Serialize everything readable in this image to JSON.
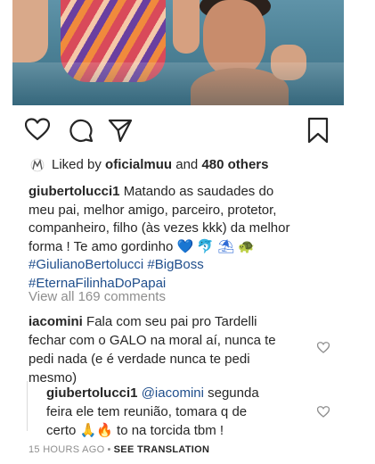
{
  "post": {
    "liked_by_prefix": "Liked by ",
    "liked_by_user": "oficialmuu",
    "liked_by_mid": " and ",
    "liked_by_count": "480 others",
    "author": "giubertolucci1",
    "caption_lines": [
      " Matando as saudades do",
      "meu pai, melhor amigo, parceiro, protetor,",
      "companheiro, filho (às vezes kkk) da melhor",
      "forma ! Te amo gordinho "
    ],
    "caption_emojis": "💙 🐬 ⛱ 🐢",
    "hashtags_line1": "#GiulianoBertolucci #BigBoss",
    "hashtags_line2": "#EternaFilinhaDoPapai",
    "view_all": "View all 169 comments"
  },
  "comments": [
    {
      "user": "iacomini",
      "lines": [
        " Fala com seu pai pro Tardelli",
        "fechar com o GALO na moral aí, nunca te",
        "pedi nada (e é verdade nunca te pedi",
        "mesmo)"
      ]
    },
    {
      "user": "giubertolucci1",
      "mention": " @iacomini",
      "lines": [
        " segunda",
        "feira ele tem reunião, tomara q de",
        "certo 🙏🔥 to na torcida tbm !"
      ]
    }
  ],
  "footer": {
    "time": "15 HOURS AGO",
    "separator": "•",
    "translate": "SEE TRANSLATION"
  },
  "icons": {
    "like": "heart-outline-icon",
    "comment": "comment-bubble-icon",
    "share": "paper-plane-icon",
    "save": "bookmark-icon"
  }
}
